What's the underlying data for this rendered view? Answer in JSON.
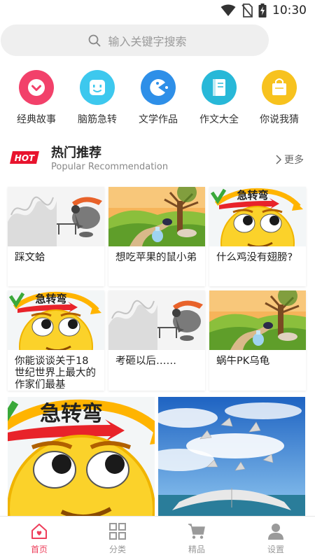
{
  "status": {
    "time": "10:30"
  },
  "search": {
    "placeholder": "输入关键字搜索"
  },
  "categories": [
    {
      "label": "经典故事",
      "icon": "chevron-down-icon",
      "color": "#f2416a"
    },
    {
      "label": "脑筋急转",
      "icon": "robot-face-icon",
      "color": "#3dc8ee"
    },
    {
      "label": "文学作品",
      "icon": "pacman-icon",
      "color": "#2e8fe8"
    },
    {
      "label": "作文大全",
      "icon": "notebook-icon",
      "color": "#28b8d8"
    },
    {
      "label": "你说我猜",
      "icon": "shopping-bag-icon",
      "color": "#f7c21e"
    }
  ],
  "section": {
    "badge": "HOT",
    "title": "热门推荐",
    "subtitle": "Popular Recommendation",
    "more": "更多"
  },
  "cards": [
    {
      "title": "踩文蛤",
      "image": "sketch"
    },
    {
      "title": "想吃苹果的鼠小弟",
      "image": "landscape"
    },
    {
      "title": "什么鸡没有翅膀?",
      "image": "emoji"
    },
    {
      "title": "你能谈谈关于18世纪世界上最大的作家们最基",
      "image": "emoji"
    },
    {
      "title": "考砸以后……",
      "image": "sketch"
    },
    {
      "title": "蜗牛PK乌龟",
      "image": "landscape"
    }
  ],
  "big_cards": [
    {
      "image": "emoji"
    },
    {
      "image": "book"
    }
  ],
  "emoji_banner": "急转弯",
  "tabs": [
    {
      "label": "首页",
      "icon": "home-icon",
      "active": true
    },
    {
      "label": "分类",
      "icon": "grid-icon",
      "active": false
    },
    {
      "label": "精品",
      "icon": "cart-icon",
      "active": false
    },
    {
      "label": "设置",
      "icon": "user-icon",
      "active": false
    }
  ],
  "colors": {
    "accent": "#ee3e5b",
    "inactive": "#999999"
  }
}
